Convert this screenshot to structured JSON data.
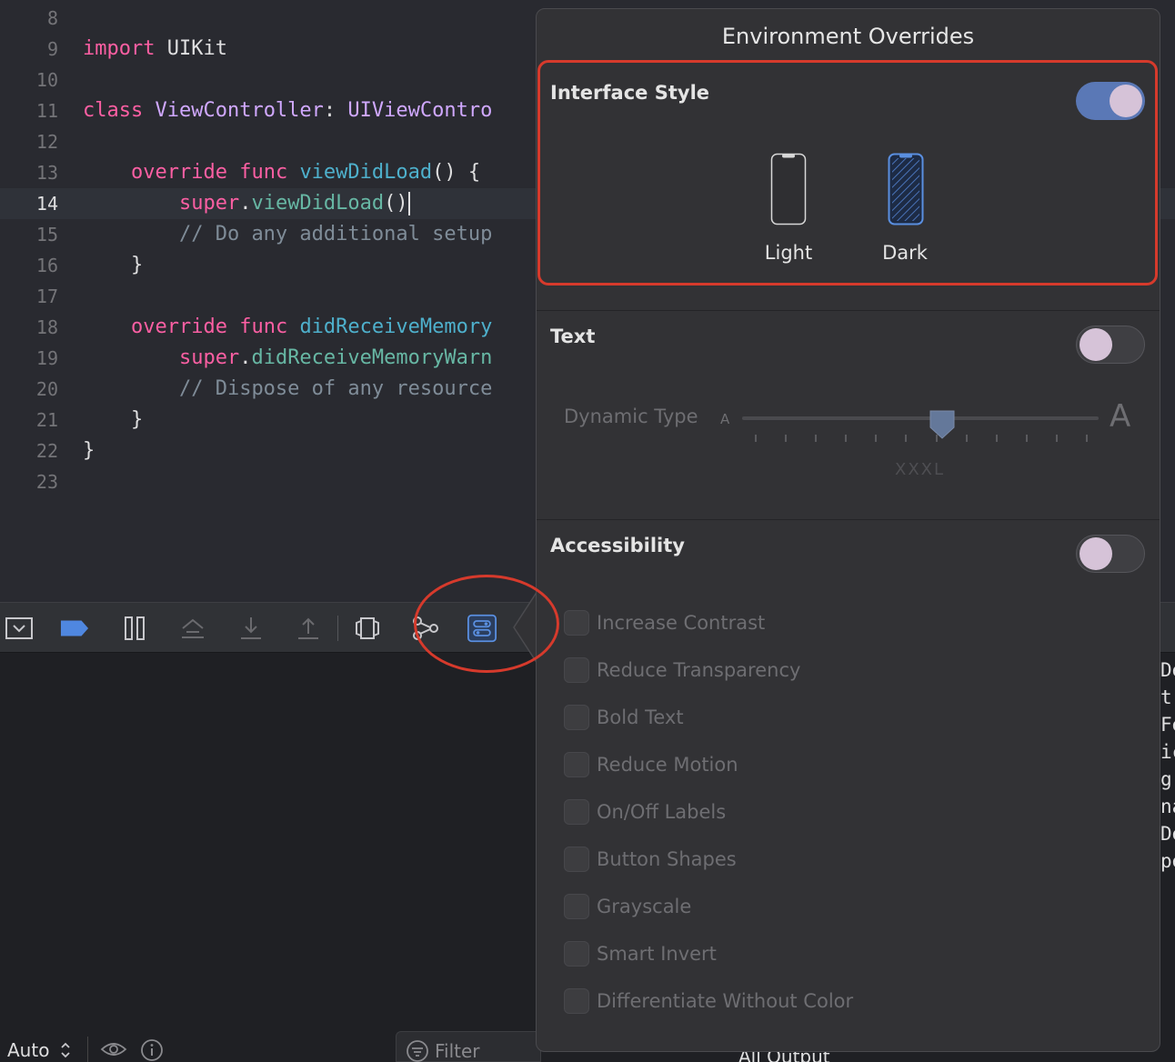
{
  "editor": {
    "lines": [
      {
        "n": "8",
        "parts": []
      },
      {
        "n": "9",
        "parts": [
          [
            "kw",
            "import"
          ],
          [
            "t",
            " UIKit"
          ]
        ]
      },
      {
        "n": "10",
        "parts": []
      },
      {
        "n": "11",
        "parts": [
          [
            "kw",
            "class"
          ],
          [
            "t",
            " "
          ],
          [
            "ty",
            "ViewController"
          ],
          [
            "t",
            ": "
          ],
          [
            "ty",
            "UIViewContro"
          ]
        ]
      },
      {
        "n": "12",
        "parts": []
      },
      {
        "n": "13",
        "parts": [
          [
            "t",
            "    "
          ],
          [
            "kw",
            "override"
          ],
          [
            "t",
            " "
          ],
          [
            "kw",
            "func"
          ],
          [
            "t",
            " "
          ],
          [
            "fnd",
            "viewDidLoad"
          ],
          [
            "t",
            "() {"
          ]
        ]
      },
      {
        "n": "14",
        "parts": [
          [
            "t",
            "        "
          ],
          [
            "kw",
            "super"
          ],
          [
            "t",
            "."
          ],
          [
            "fn",
            "viewDidLoad"
          ],
          [
            "t",
            "()"
          ],
          [
            "caret",
            ""
          ]
        ],
        "current": true
      },
      {
        "n": "15",
        "parts": [
          [
            "t",
            "        "
          ],
          [
            "cm",
            "// Do any additional setup"
          ]
        ]
      },
      {
        "n": "16",
        "parts": [
          [
            "t",
            "    }"
          ]
        ]
      },
      {
        "n": "17",
        "parts": []
      },
      {
        "n": "18",
        "parts": [
          [
            "t",
            "    "
          ],
          [
            "kw",
            "override"
          ],
          [
            "t",
            " "
          ],
          [
            "kw",
            "func"
          ],
          [
            "t",
            " "
          ],
          [
            "fnd",
            "didReceiveMemory"
          ]
        ]
      },
      {
        "n": "19",
        "parts": [
          [
            "t",
            "        "
          ],
          [
            "kw",
            "super"
          ],
          [
            "t",
            "."
          ],
          [
            "fn",
            "didReceiveMemoryWarn"
          ]
        ]
      },
      {
        "n": "20",
        "parts": [
          [
            "t",
            "        "
          ],
          [
            "cm",
            "// Dispose of any resource"
          ]
        ]
      },
      {
        "n": "21",
        "parts": [
          [
            "t",
            "    }"
          ]
        ]
      },
      {
        "n": "22",
        "parts": [
          [
            "t",
            "}"
          ]
        ]
      },
      {
        "n": "23",
        "parts": []
      }
    ]
  },
  "debug_bar": {
    "icons": [
      "hide-debug-area-icon",
      "breakpoints-icon",
      "pause-icon",
      "step-over-icon",
      "step-into-icon",
      "step-out-icon",
      "view-hierarchy-icon",
      "memory-graph-icon",
      "environment-overrides-icon"
    ]
  },
  "console": {
    "right_fragments": [
      "De",
      "t",
      "Fe",
      "ic",
      "g",
      "na",
      "De",
      "pe"
    ]
  },
  "bottom_bar": {
    "scope_label": "Auto",
    "filter_placeholder": "Filter",
    "output_label": "All Output"
  },
  "popover": {
    "title": "Environment Overrides",
    "interface_style": {
      "title": "Interface Style",
      "enabled": true,
      "options": [
        "Light",
        "Dark"
      ],
      "selected": "Dark"
    },
    "text": {
      "title": "Text",
      "enabled": false,
      "dynamic_type_label": "Dynamic Type",
      "small_a": "A",
      "large_a": "A",
      "size_value": "XXXL",
      "slider_position": 0.56
    },
    "accessibility": {
      "title": "Accessibility",
      "enabled": false,
      "options": [
        "Increase Contrast",
        "Reduce Transparency",
        "Bold Text",
        "Reduce Motion",
        "On/Off Labels",
        "Button Shapes",
        "Grayscale",
        "Smart Invert",
        "Differentiate Without Color"
      ]
    }
  },
  "colors": {
    "accent": "#5a78b6",
    "annotation": "#d63a2c",
    "keyword": "#fc5fa3",
    "type": "#d0a8ff"
  }
}
